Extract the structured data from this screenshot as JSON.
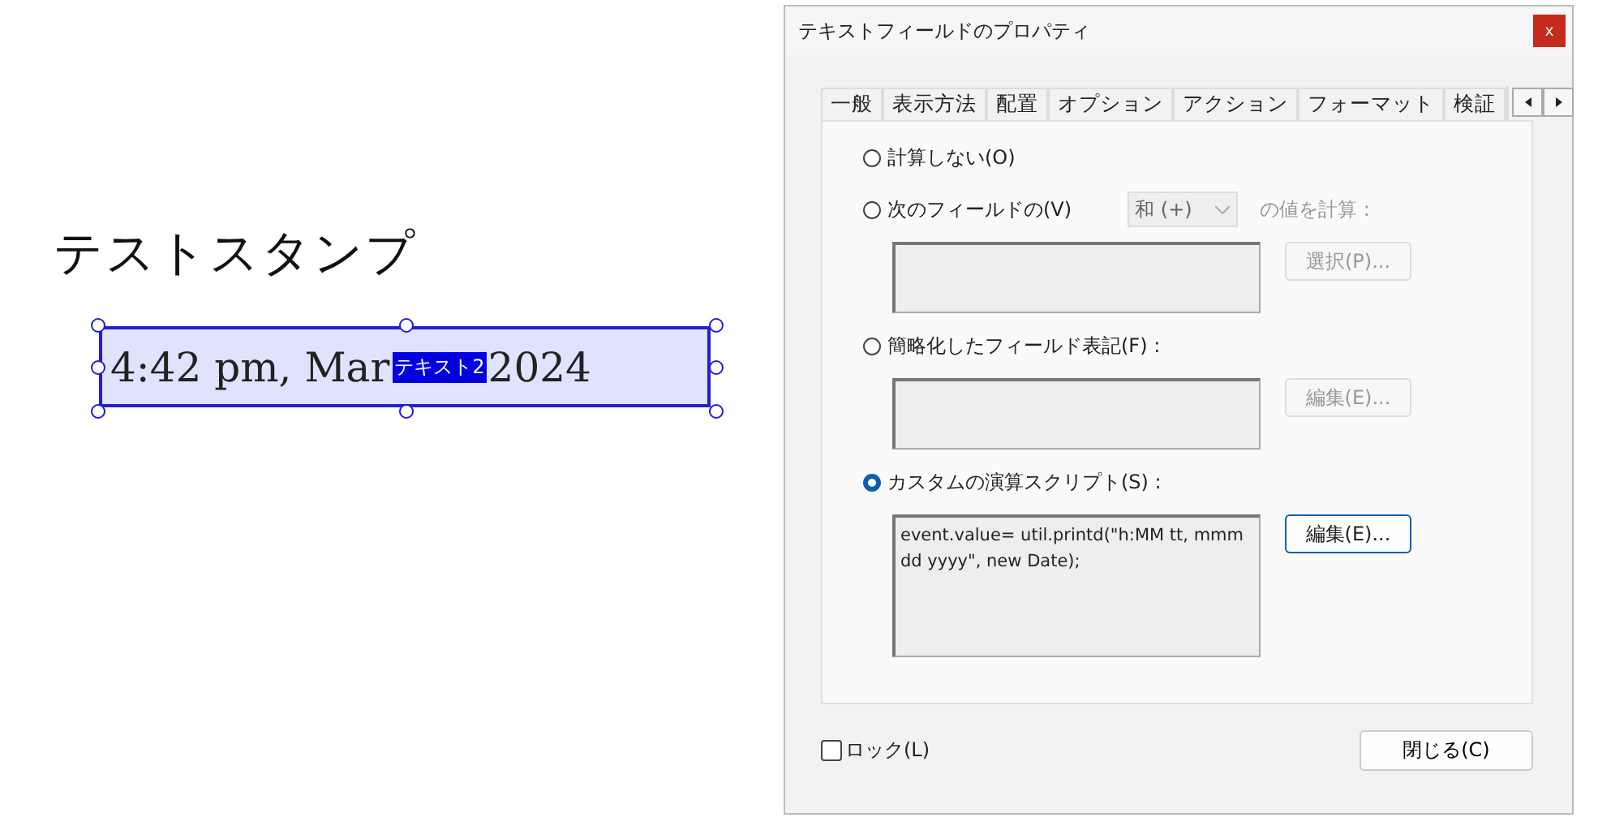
{
  "page": {
    "heading": "テストスタンプ",
    "field": {
      "value_start": "4:42 pm, Mar",
      "value_end": "2024",
      "tag": "テキスト2",
      "selected": true
    }
  },
  "dialog": {
    "title": "テキストフィールドのプロパティ",
    "close_glyph": "x",
    "tabs": [
      "一般",
      "表示方法",
      "配置",
      "オプション",
      "アクション",
      "フォーマット",
      "検証"
    ],
    "options": [
      {
        "kind": "plain",
        "label": "計算しない(O)",
        "selected": false
      },
      {
        "kind": "fields",
        "label": "次のフィールドの(V)",
        "selected": false,
        "operator": "和 (+)",
        "suffix": "の値を計算 :",
        "button": {
          "label": "選択(P)...",
          "disabled": true
        }
      },
      {
        "kind": "box",
        "label": "簡略化したフィールド表記(F) :",
        "selected": false,
        "button": {
          "label": "編集(E)...",
          "disabled": true
        }
      },
      {
        "kind": "box",
        "label": "カスタムの演算スクリプト(S) :",
        "selected": true,
        "script": "event.value= util.printd(\"h:MM tt, mmm dd yyyy\", new Date);",
        "button": {
          "label": "編集(E)...",
          "disabled": false
        }
      }
    ],
    "lock": {
      "label": "ロック(L)",
      "checked": false
    },
    "close_button": "閉じる(C)"
  }
}
